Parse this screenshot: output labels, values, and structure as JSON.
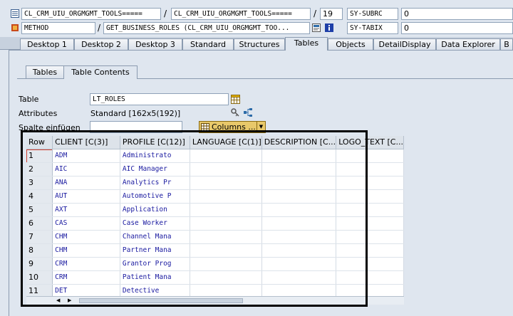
{
  "header": {
    "row1": {
      "field1": "CL_CRM_UIU_ORGMGMT_TOOLS=====",
      "field2": "CL_CRM_UIU_ORGMGMT_TOOLS=====",
      "sep": "/",
      "line_no": "19",
      "sysvar_name": "SY-SUBRC",
      "sysvar_value": "0"
    },
    "row2": {
      "type": "METHOD",
      "method": "GET_BUSINESS_ROLES (CL_CRM_UIU_ORGMGMT_TOO...",
      "sep": "/",
      "sysvar_name": "SY-TABIX",
      "sysvar_value": "0"
    }
  },
  "main_tabs": [
    "Desktop 1",
    "Desktop 2",
    "Desktop 3",
    "Standard",
    "Structures",
    "Tables",
    "Objects",
    "DetailDisplay",
    "Data Explorer",
    "B"
  ],
  "sub_tabs": [
    "Tables",
    "Table Contents"
  ],
  "form": {
    "table_label": "Table",
    "table_value": "LT_ROLES",
    "attributes_label": "Attributes",
    "attributes_value": "Standard [162x5(192)]",
    "insert_col_label": "Spalte einfügen",
    "columns_button": "Columns ..."
  },
  "grid": {
    "headers": [
      "Row",
      "CLIENT [C(3)]",
      "PROFILE [C(12)]",
      "LANGUAGE [C(1)]",
      "DESCRIPTION [C...",
      "LOGO_TEXT [C..."
    ],
    "rows": [
      [
        "1",
        "ADM",
        "Administrato"
      ],
      [
        "2",
        "AIC",
        "AIC Manager"
      ],
      [
        "3",
        "ANA",
        "Analytics Pr"
      ],
      [
        "4",
        "AUT",
        "Automotive P"
      ],
      [
        "5",
        "AXT",
        "Application"
      ],
      [
        "6",
        "CAS",
        "Case Worker"
      ],
      [
        "7",
        "CHM",
        "Channel Mana"
      ],
      [
        "8",
        "CHM",
        "Partner Mana"
      ],
      [
        "9",
        "CRM",
        "Grantor Prog"
      ],
      [
        "10",
        "CRM",
        "Patient Mana"
      ],
      [
        "11",
        "DET",
        "Detective"
      ]
    ]
  },
  "icons": {
    "row1": "list-icon",
    "row2": "method-icon",
    "edit": "edit-icon",
    "info": "info-icon",
    "table_picker": "table-icon",
    "attributes_key": "key-icon",
    "attributes_tree": "hierarchy-icon",
    "columns": "grid-icon",
    "columns_dropdown": "chevron-down-icon"
  }
}
